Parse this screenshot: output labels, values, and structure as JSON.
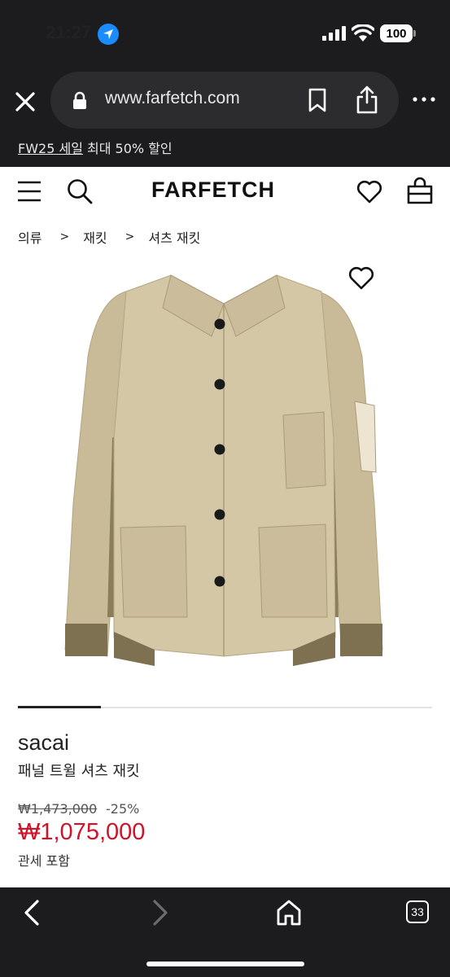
{
  "status_bar": {
    "time": "21:27",
    "battery": "100",
    "icons": [
      "location-arrow-icon",
      "signal-icon",
      "wifi-icon",
      "battery-icon"
    ]
  },
  "browser": {
    "url": "www.farfetch.com",
    "icons": [
      "close-icon",
      "lock-icon",
      "bookmark-icon",
      "share-icon",
      "more-icon"
    ]
  },
  "promo": {
    "link_text": "FW25 세일",
    "rest_text": " 최대 50% 할인"
  },
  "header": {
    "logo": "FARFETCH",
    "icons": [
      "menu-icon",
      "search-icon",
      "heart-icon",
      "bag-icon"
    ]
  },
  "breadcrumb": {
    "items": [
      "의류",
      "재킷",
      "셔츠 재킷"
    ],
    "separator": ">"
  },
  "product": {
    "brand": "sacai",
    "name": "패널 트윌 셔츠 재킷",
    "original_price": "₩1,473,000",
    "discount": "-25%",
    "sale_price": "₩1,075,000",
    "duty_note": "관세 포함",
    "image_description_icon": "jacket-image",
    "colors": {
      "sale": "#d1132a",
      "jacket": "#cfc2a3",
      "panel": "#8a7d5a"
    }
  },
  "bottom_nav": {
    "tab_count": "33",
    "icons": [
      "back-icon",
      "forward-icon",
      "home-icon",
      "tabs-icon"
    ]
  }
}
